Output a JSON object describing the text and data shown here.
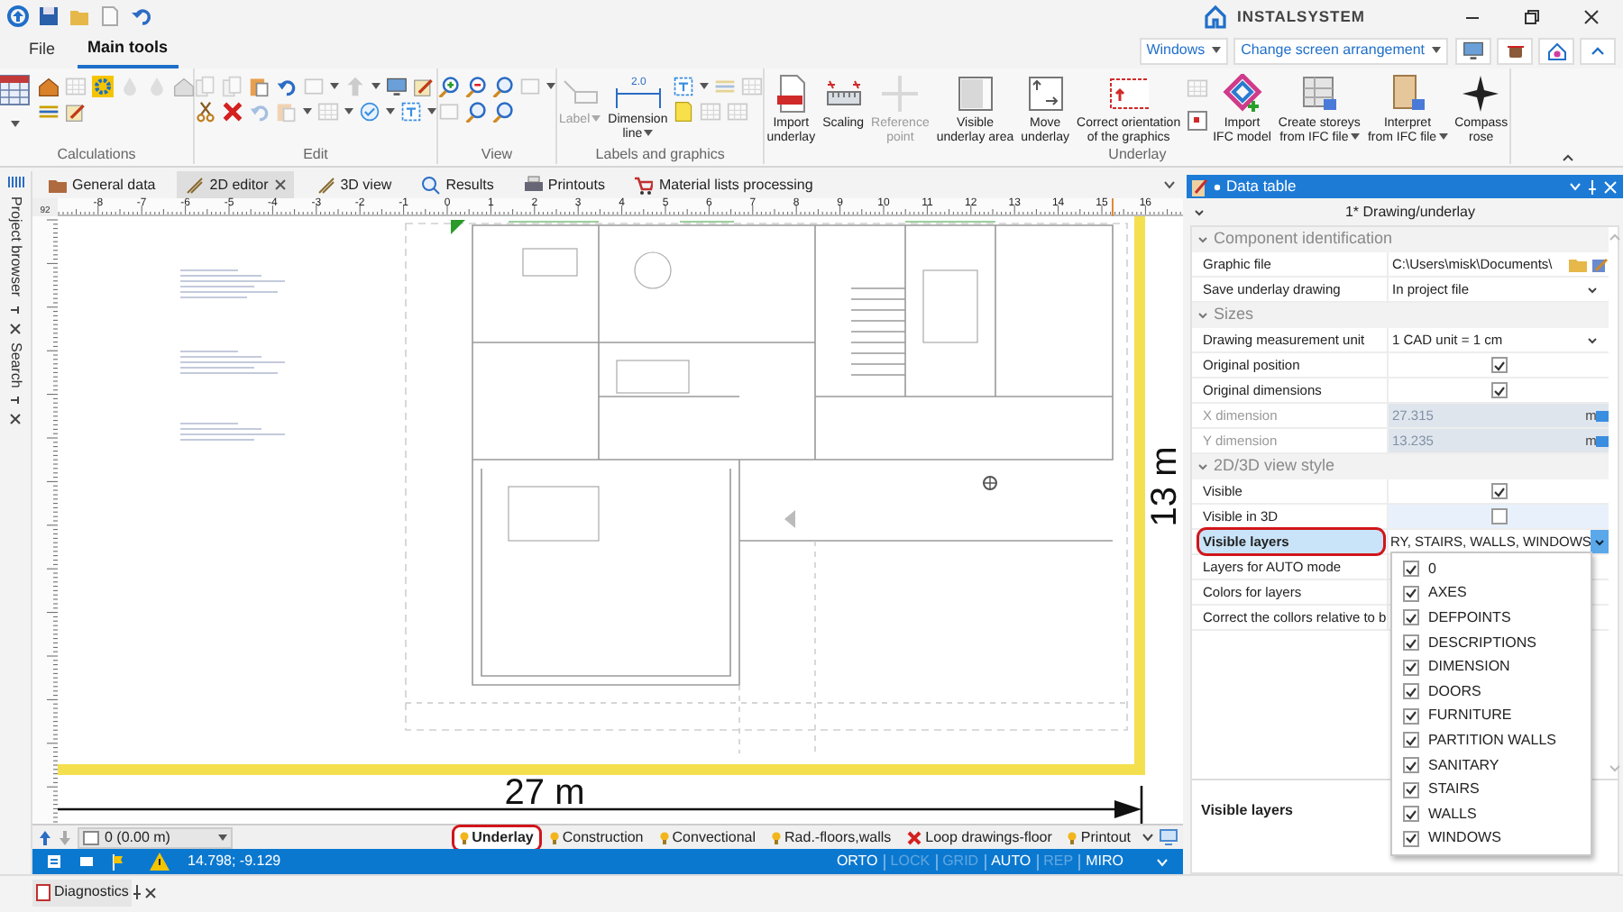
{
  "title_bar": {
    "brand": "INSTALSYSTEM"
  },
  "menu_tabs": [
    {
      "label": "File",
      "selected": false
    },
    {
      "label": "Main tools",
      "selected": true
    }
  ],
  "top_controls": {
    "windows": "Windows",
    "arrangement": "Change screen arrangement"
  },
  "ribbon": {
    "groups": [
      {
        "title": "Calculations"
      },
      {
        "title": "Edit"
      },
      {
        "title": "View"
      },
      {
        "title": "Labels and graphics",
        "buttons": [
          {
            "label": "Label",
            "disabled": true,
            "dropdown": true
          },
          {
            "label": "Dimension\nline",
            "disabled": false,
            "dropdown": true,
            "sample": "2.0"
          }
        ]
      },
      {
        "title": "Underlay",
        "buttons": [
          {
            "label": "Import\nunderlay",
            "disabled": false,
            "dropdown": false
          },
          {
            "label": "Scaling",
            "disabled": false,
            "dropdown": false
          },
          {
            "label": "Reference\npoint",
            "disabled": true,
            "dropdown": false
          },
          {
            "label": "Visible\nunderlay area",
            "disabled": false,
            "dropdown": false
          },
          {
            "label": "Move\nunderlay",
            "disabled": false,
            "dropdown": false
          },
          {
            "label": "Correct orientation\nof the graphics",
            "disabled": false,
            "dropdown": false
          },
          {
            "label": "Import\nIFC model",
            "disabled": false,
            "dropdown": false
          },
          {
            "label": "Create storeys\nfrom IFC file",
            "disabled": false,
            "dropdown": true
          },
          {
            "label": "Interpret\nfrom IFC file",
            "disabled": false,
            "dropdown": true
          },
          {
            "label": "Compass\nrose",
            "disabled": false,
            "dropdown": false
          }
        ]
      }
    ]
  },
  "side_tabs": [
    {
      "label": "Project browser"
    },
    {
      "label": "Search"
    }
  ],
  "doc_tabs": [
    {
      "label": "General data",
      "selected": false
    },
    {
      "label": "2D editor",
      "selected": true
    },
    {
      "label": "3D view",
      "selected": false
    },
    {
      "label": "Results",
      "selected": false
    },
    {
      "label": "Printouts",
      "selected": false
    },
    {
      "label": "Material lists processing",
      "selected": false
    }
  ],
  "ruler": {
    "corner": "92",
    "labels": [
      "-8",
      "-7",
      "-6",
      "-5",
      "-4",
      "-3",
      "-2",
      "-1",
      "0",
      "1",
      "2",
      "3",
      "4",
      "5",
      "6",
      "7",
      "8",
      "9",
      "10",
      "11",
      "12",
      "13",
      "14",
      "15",
      "16"
    ]
  },
  "drawing": {
    "width_label": "27 m",
    "height_label": "13 m"
  },
  "floor_select": {
    "value": "0 (0.00 m)"
  },
  "layer_tabs": [
    {
      "label": "Underlay",
      "selected": true,
      "visible": true,
      "circled": true
    },
    {
      "label": "Construction",
      "selected": false,
      "visible": true,
      "circled": false
    },
    {
      "label": "Convectional",
      "selected": false,
      "visible": true,
      "circled": false
    },
    {
      "label": "Rad.-floors,walls",
      "selected": false,
      "visible": true,
      "circled": false
    },
    {
      "label": "Loop drawings-floor",
      "selected": false,
      "visible": false,
      "circled": false
    },
    {
      "label": "Printout",
      "selected": false,
      "visible": true,
      "circled": false
    }
  ],
  "status_bar": {
    "coordinates": "14.798; -9.129",
    "toggles": [
      {
        "label": "ORTO",
        "enabled": true
      },
      {
        "label": "LOCK",
        "enabled": false
      },
      {
        "label": "GRID",
        "enabled": false
      },
      {
        "label": "AUTO",
        "enabled": true
      },
      {
        "label": "REP",
        "enabled": false
      },
      {
        "label": "MIRO",
        "enabled": true
      }
    ]
  },
  "data_table": {
    "title": "Data table",
    "object": "1* Drawing/underlay",
    "sections": [
      {
        "title": "Component identification",
        "expanded": true,
        "rows": [
          {
            "kind": "file",
            "label": "Graphic file",
            "value": "C:\\Users\\misk\\Documents\\",
            "selected": false,
            "disabled": false
          },
          {
            "kind": "select",
            "label": "Save underlay drawing",
            "value": "In project file",
            "selected": false,
            "disabled": false
          }
        ]
      },
      {
        "title": "Sizes",
        "expanded": true,
        "rows": [
          {
            "kind": "select",
            "label": "Drawing measurement unit",
            "value": "1 CAD unit = 1 cm",
            "selected": false,
            "disabled": false
          },
          {
            "kind": "check",
            "label": "Original position",
            "checked": true,
            "selected": false,
            "disabled": false
          },
          {
            "kind": "check",
            "label": "Original dimensions",
            "checked": true,
            "selected": false,
            "disabled": false
          },
          {
            "kind": "measure",
            "label": "X dimension",
            "value": "27.315",
            "unit": "m",
            "selected": false,
            "disabled": true
          },
          {
            "kind": "measure",
            "label": "Y dimension",
            "value": "13.235",
            "unit": "m",
            "selected": false,
            "disabled": true
          }
        ]
      },
      {
        "title": "2D/3D view style",
        "expanded": true,
        "rows": [
          {
            "kind": "check",
            "label": "Visible",
            "checked": true,
            "selected": false,
            "disabled": false
          },
          {
            "kind": "check",
            "label": "Visible in 3D",
            "checked": false,
            "selected": false,
            "disabled": false
          },
          {
            "kind": "layers",
            "label": "Visible layers",
            "value": "RY, STAIRS, WALLS, WINDOWS",
            "selected": true,
            "disabled": false,
            "circled": true
          },
          {
            "kind": "plain",
            "label": "Layers for AUTO mode",
            "selected": false,
            "disabled": false
          },
          {
            "kind": "plain",
            "label": "Colors for layers",
            "selected": false,
            "disabled": false
          },
          {
            "kind": "plain",
            "label": "Correct the collors relative to b",
            "selected": false,
            "disabled": false
          }
        ]
      }
    ],
    "layer_options": [
      {
        "label": "0",
        "checked": true
      },
      {
        "label": "AXES",
        "checked": true
      },
      {
        "label": "DEFPOINTS",
        "checked": true
      },
      {
        "label": "DESCRIPTIONS",
        "checked": true
      },
      {
        "label": "DIMENSION",
        "checked": true
      },
      {
        "label": "DOORS",
        "checked": true
      },
      {
        "label": "FURNITURE",
        "checked": true
      },
      {
        "label": "PARTITION WALLS",
        "checked": true
      },
      {
        "label": "SANITARY",
        "checked": true
      },
      {
        "label": "STAIRS",
        "checked": true
      },
      {
        "label": "WALLS",
        "checked": true
      },
      {
        "label": "WINDOWS",
        "checked": true
      }
    ],
    "description": "Visible layers"
  },
  "diagnostics": {
    "label": "Diagnostics"
  }
}
